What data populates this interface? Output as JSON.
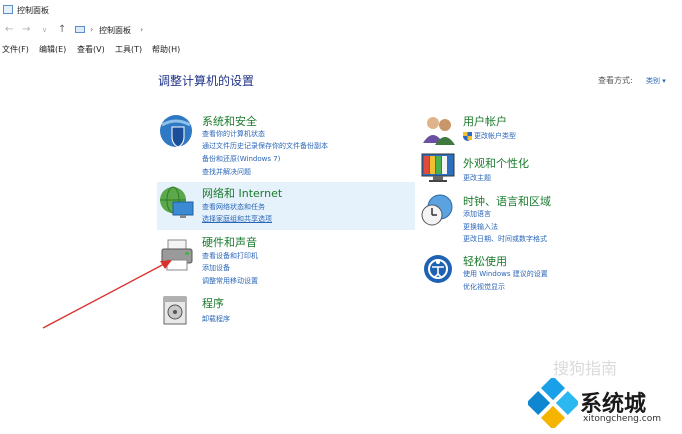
{
  "window": {
    "title": "控制面板"
  },
  "address": {
    "nav": [
      "←",
      "→",
      "∨",
      "↑"
    ],
    "sep1": "›",
    "crumb": "控制面板",
    "sep2": "›"
  },
  "menu": [
    "文件(F)",
    "编辑(E)",
    "查看(V)",
    "工具(T)",
    "帮助(H)"
  ],
  "main": {
    "heading": "调整计算机的设置",
    "view_by_label": "查看方式:",
    "view_by_value": "类别 ▾"
  },
  "categories": {
    "system": {
      "title": "系统和安全",
      "links": [
        "查看你的计算机状态",
        "通过文件历史记录保存你的文件备份副本",
        "备份和还原(Windows 7)",
        "查找并解决问题"
      ]
    },
    "network": {
      "title": "网络和 Internet",
      "links": [
        "查看网络状态和任务",
        "选择家庭组和共享选项"
      ]
    },
    "hardware": {
      "title": "硬件和声音",
      "links": [
        "查看设备和打印机",
        "添加设备",
        "调整常用移动设置"
      ]
    },
    "programs": {
      "title": "程序",
      "links": [
        "卸载程序"
      ]
    },
    "users": {
      "title": "用户帐户",
      "links": [
        "更改帐户类型"
      ]
    },
    "appearance": {
      "title": "外观和个性化",
      "links": [
        "更改主题"
      ]
    },
    "clock": {
      "title": "时钟、语言和区域",
      "links": [
        "添加语言",
        "更换输入法",
        "更改日期、时间或数字格式"
      ]
    },
    "ease": {
      "title": "轻松使用",
      "links": [
        "使用 Windows 建议的设置",
        "优化视觉显示"
      ]
    }
  },
  "watermark": {
    "sogou": "搜狗指南",
    "brand": "系统城",
    "url": "xitongcheng.com"
  },
  "colors": {
    "title_green": "#1a7a2c",
    "link_blue": "#2a66b8",
    "heading_blue": "#1e3287",
    "highlight": "#e6f2fb",
    "arrow_red": "#d9302a"
  }
}
